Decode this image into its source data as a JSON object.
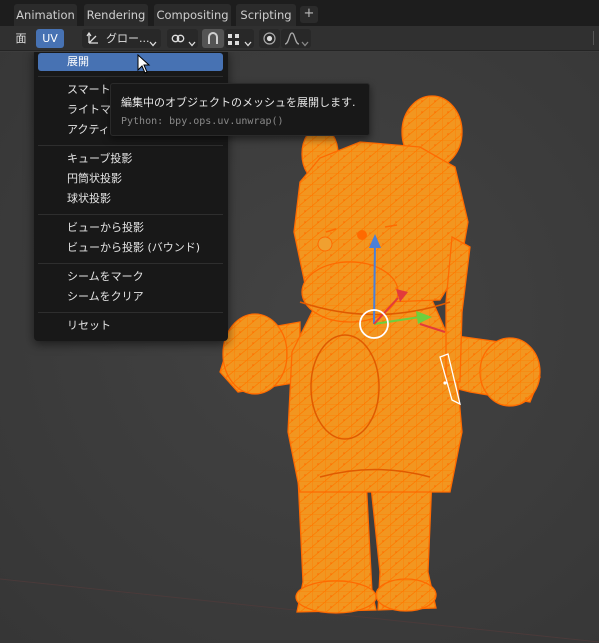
{
  "workspace_tabs": [
    "Animation",
    "Rendering",
    "Compositing",
    "Scripting"
  ],
  "add_tab_label": "+",
  "header": {
    "face_menu_label": "面",
    "uv_menu_label": "UV",
    "transform_orientation_label": "グロー...",
    "chevron": "⌄"
  },
  "uv_menu": {
    "items": [
      {
        "label": "展開",
        "active": true
      },
      {
        "label": "スマートUV投影"
      },
      {
        "label": "ライトマップパック"
      },
      {
        "label": "アクティブ四角面に追従"
      },
      {
        "label": "キューブ投影"
      },
      {
        "label": "円筒状投影"
      },
      {
        "label": "球状投影"
      },
      {
        "label": "ビューから投影"
      },
      {
        "label": "ビューから投影 (バウンド)"
      },
      {
        "label": "シームをマーク"
      },
      {
        "label": "シームをクリア"
      },
      {
        "label": "リセット"
      }
    ]
  },
  "tooltip": {
    "title": "編集中のオブジェクトのメッシュを展開します.",
    "python": "Python: bpy.ops.uv.unwrap()"
  },
  "icons": [
    "mouse-cursor-icon",
    "gizmo-icon",
    "snap-icon",
    "grid-icon",
    "proportional-edit-icon",
    "falloff-curve-icon",
    "link-icon"
  ],
  "colors": {
    "mesh_fill": "#f29620",
    "mesh_wire": "#ff7a00",
    "menu_active": "#4772b3",
    "gizmo_x": "#e23b3b",
    "gizmo_y": "#6ccf3e",
    "gizmo_z": "#4a80d8"
  }
}
